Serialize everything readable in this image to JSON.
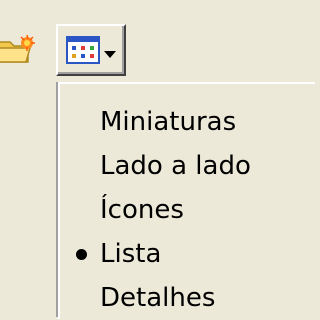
{
  "toolbar": {
    "left_icon": "up-folder-icon",
    "view_button": {
      "icon": "view-grid-icon",
      "arrow_icon": "dropdown-arrow-icon"
    }
  },
  "view_menu": {
    "items": [
      {
        "label": "Miniaturas",
        "selected": false
      },
      {
        "label": "Lado a lado",
        "selected": false
      },
      {
        "label": "Ícones",
        "selected": false
      },
      {
        "label": "Lista",
        "selected": true
      },
      {
        "label": "Detalhes",
        "selected": false
      }
    ],
    "selected_marker_icon": "bullet-icon"
  },
  "colors": {
    "chrome": "#ece9d8",
    "highlight": "#ffffff",
    "shadow": "#404040",
    "text": "#000000"
  }
}
